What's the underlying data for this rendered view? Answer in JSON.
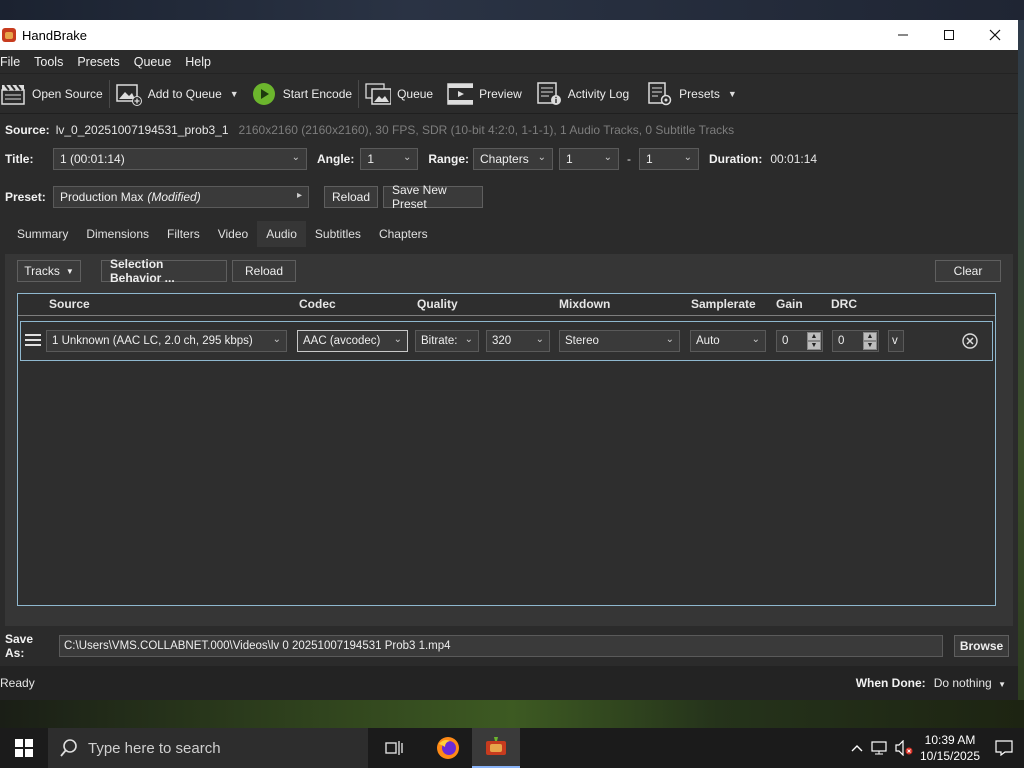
{
  "window": {
    "title": "HandBrake"
  },
  "menu": [
    "File",
    "Tools",
    "Presets",
    "Queue",
    "Help"
  ],
  "toolbar": {
    "open_source": "Open Source",
    "add_to_queue": "Add to Queue",
    "start_encode": "Start Encode",
    "queue": "Queue",
    "preview": "Preview",
    "activity_log": "Activity Log",
    "presets": "Presets"
  },
  "source": {
    "label": "Source:",
    "name": "lv_0_20251007194531_prob3_1",
    "info": "2160x2160 (2160x2160), 30 FPS, SDR (10-bit 4:2:0, 1-1-1), 1 Audio Tracks, 0 Subtitle Tracks"
  },
  "title_row": {
    "title_label": "Title:",
    "title_value": "1  (00:01:14)",
    "angle_label": "Angle:",
    "angle_value": "1",
    "range_label": "Range:",
    "range_mode": "Chapters",
    "range_start": "1",
    "range_dash": "-",
    "range_end": "1",
    "duration_label": "Duration:",
    "duration_value": "00:01:14"
  },
  "preset_row": {
    "label": "Preset:",
    "value": "Production Max",
    "modified": "(Modified)",
    "reload": "Reload",
    "save_new": "Save New Preset"
  },
  "tabs": [
    "Summary",
    "Dimensions",
    "Filters",
    "Video",
    "Audio",
    "Subtitles",
    "Chapters"
  ],
  "active_tab": "Audio",
  "audio": {
    "tracks_button": "Tracks",
    "selection_behavior": "Selection Behavior ...",
    "reload": "Reload",
    "clear": "Clear",
    "headers": {
      "source": "Source",
      "codec": "Codec",
      "quality": "Quality",
      "mixdown": "Mixdown",
      "samplerate": "Samplerate",
      "gain": "Gain",
      "drc": "DRC"
    },
    "track": {
      "source": "1 Unknown (AAC LC, 2.0 ch, 295 kbps)",
      "codec": "AAC (avcodec)",
      "quality_mode": "Bitrate:",
      "bitrate": "320",
      "mixdown": "Stereo",
      "samplerate": "Auto",
      "gain": "0",
      "drc": "0",
      "more": "v"
    }
  },
  "save_as": {
    "label": "Save As:",
    "path": "C:\\Users\\VMS.COLLABNET.000\\Videos\\lv 0 20251007194531 Prob3 1.mp4",
    "browse": "Browse"
  },
  "status": {
    "text": "Ready",
    "when_done_label": "When Done:",
    "when_done_value": "Do nothing"
  },
  "taskbar": {
    "search_placeholder": "Type here to search",
    "time": "10:39 AM",
    "date": "10/15/2025"
  }
}
